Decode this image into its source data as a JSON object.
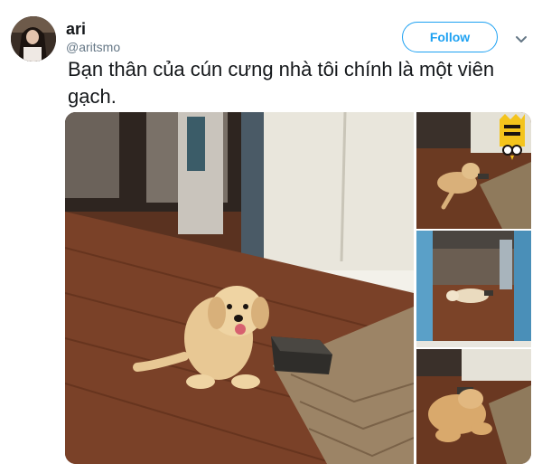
{
  "user": {
    "name": "ari",
    "handle": "@aritsmo"
  },
  "follow_button": {
    "label": "Follow"
  },
  "tweet": {
    "text": "Bạn thân của cún cưng nhà tôi chính là một viên gạch."
  },
  "media": {
    "photos": [
      {
        "id": "photo-main",
        "subject": "golden-retriever-puppy-sitting-next-to-brick"
      },
      {
        "id": "photo-2",
        "subject": "puppy-lying-on-floor"
      },
      {
        "id": "photo-3",
        "subject": "puppy-lying-in-doorway"
      },
      {
        "id": "photo-4",
        "subject": "puppy-sleeping-on-brick"
      }
    ]
  },
  "colors": {
    "accent": "#1da1f2",
    "handle": "#657786",
    "text": "#14171a"
  },
  "icons": {
    "menu": "chevron-down-icon",
    "watermark": "crown-logo-icon"
  }
}
